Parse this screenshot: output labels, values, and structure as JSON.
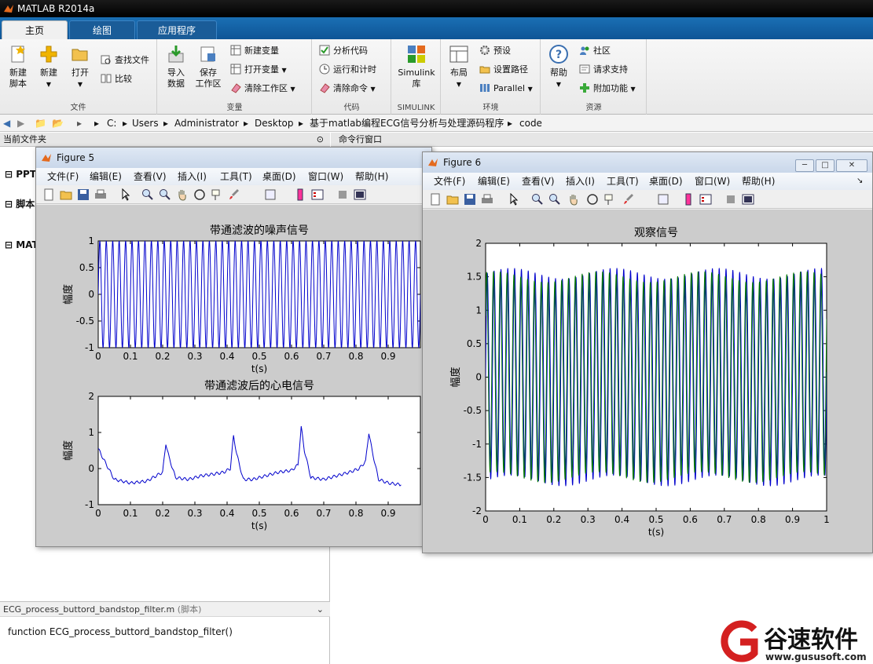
{
  "app": {
    "title": "MATLAB R2014a"
  },
  "tabs": [
    {
      "label": "主页"
    },
    {
      "label": "绘图"
    },
    {
      "label": "应用程序"
    }
  ],
  "ribbon": {
    "file": {
      "group_label": "文件",
      "new_script": "新建\n脚本",
      "new_script_l1": "新建",
      "new_script_l2": "脚本",
      "new": "新建",
      "open": "打开",
      "find_files": "查找文件",
      "compare": "比较"
    },
    "variable": {
      "group_label": "变量",
      "import_l1": "导入",
      "import_l2": "数据",
      "save_l1": "保存",
      "save_l2": "工作区",
      "new_var": "新建变量",
      "open_var": "打开变量",
      "clear_ws": "清除工作区"
    },
    "code": {
      "group_label": "代码",
      "analyze": "分析代码",
      "run_time": "运行和计时",
      "clear_cmd": "清除命令"
    },
    "simulink": {
      "group_label": "SIMULINK",
      "l1": "Simulink",
      "l2": "库"
    },
    "env": {
      "group_label": "环境",
      "layout": "布局",
      "prefs": "预设",
      "set_path": "设置路径",
      "parallel": "Parallel"
    },
    "resources": {
      "group_label": "资源",
      "help": "帮助",
      "community": "社区",
      "support": "请求支持",
      "addons": "附加功能"
    }
  },
  "path": [
    "C:",
    "Users",
    "Administrator",
    "Desktop",
    "基于matlab编程ECG信号分析与处理源码程序",
    "code"
  ],
  "panels": {
    "current_folder": "当前文件夹",
    "command_window": "命令行窗口",
    "tree": [
      "PPT",
      "脚本",
      "MAT"
    ],
    "detail_file": "ECG_process_buttord_bandstop_filter.m",
    "detail_tag": "(脚本)",
    "detail_content": "function ECG_process_buttord_bandstop_filter()"
  },
  "figure5": {
    "title": "Figure 5",
    "menu": [
      "文件(F)",
      "编辑(E)",
      "查看(V)",
      "插入(I)",
      "工具(T)",
      "桌面(D)",
      "窗口(W)",
      "帮助(H)"
    ]
  },
  "figure6": {
    "title": "Figure 6",
    "menu": [
      "文件(F)",
      "编辑(E)",
      "查看(V)",
      "插入(I)",
      "工具(T)",
      "桌面(D)",
      "窗口(W)",
      "帮助(H)"
    ]
  },
  "chart_data": [
    {
      "type": "line",
      "title": "带通滤波的噪声信号",
      "xlabel": "t(s)",
      "ylabel": "幅度",
      "xlim": [
        0,
        1
      ],
      "ylim": [
        -1,
        1
      ],
      "xticks": [
        "0",
        "0.1",
        "0.2",
        "0.3",
        "0.4",
        "0.5",
        "0.6",
        "0.7",
        "0.8",
        "0.9"
      ],
      "yticks": [
        "1",
        "0.5",
        "0",
        "-0.5",
        "-1"
      ],
      "series": [
        {
          "color": "#0000cc",
          "frequency_hz": 50,
          "amplitude": 1
        }
      ]
    },
    {
      "type": "line",
      "title": "带通滤波后的心电信号",
      "xlabel": "t(s)",
      "ylabel": "幅度",
      "xlim": [
        0,
        1
      ],
      "ylim": [
        -1,
        2
      ],
      "xticks": [
        "0",
        "0.1",
        "0.2",
        "0.3",
        "0.4",
        "0.5",
        "0.6",
        "0.7",
        "0.8",
        "0.9"
      ],
      "yticks": [
        "2",
        "1",
        "0",
        "-1"
      ],
      "series": [
        {
          "color": "#0000cc",
          "x": [
            0,
            0.02,
            0.05,
            0.1,
            0.15,
            0.18,
            0.2,
            0.21,
            0.22,
            0.24,
            0.28,
            0.32,
            0.36,
            0.39,
            0.41,
            0.42,
            0.43,
            0.45,
            0.48,
            0.52,
            0.56,
            0.6,
            0.62,
            0.63,
            0.64,
            0.66,
            0.7,
            0.74,
            0.78,
            0.81,
            0.83,
            0.84,
            0.85,
            0.87,
            0.9,
            0.94
          ],
          "y": [
            0.55,
            0.2,
            -0.3,
            -0.4,
            -0.35,
            -0.2,
            -0.1,
            0.7,
            0.3,
            -0.25,
            -0.3,
            -0.2,
            -0.15,
            -0.1,
            0.0,
            0.9,
            0.4,
            -0.3,
            -0.3,
            -0.2,
            -0.1,
            -0.05,
            0.1,
            1.15,
            0.5,
            -0.25,
            -0.3,
            -0.2,
            -0.1,
            0.0,
            0.2,
            1.0,
            0.5,
            -0.3,
            -0.4,
            -0.45
          ]
        }
      ]
    },
    {
      "type": "line",
      "title": "观察信号",
      "xlabel": "t(s)",
      "ylabel": "幅度",
      "xlim": [
        0,
        1
      ],
      "ylim": [
        -2,
        2
      ],
      "xticks": [
        "0",
        "0.1",
        "0.2",
        "0.3",
        "0.4",
        "0.5",
        "0.6",
        "0.7",
        "0.8",
        "0.9",
        "1"
      ],
      "yticks": [
        "2",
        "1.5",
        "1",
        "0.5",
        "0",
        "-0.5",
        "-1",
        "-1.5",
        "-2"
      ],
      "series": [
        {
          "color": "#0000cc",
          "frequency_hz": 50,
          "amplitude": 1.55
        },
        {
          "color": "#007700",
          "frequency_hz": 50,
          "amplitude": 1.5
        }
      ]
    }
  ],
  "watermark": {
    "brand": "谷速软件",
    "url": "www.gususoft.com"
  },
  "colors": {
    "accent": "#1a6fb4",
    "plot_bg": "#ffffff",
    "figure_bg": "#cccccc"
  }
}
